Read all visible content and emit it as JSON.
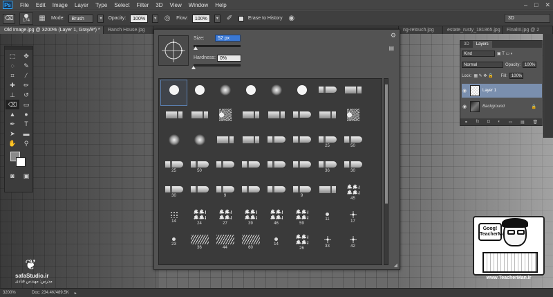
{
  "menubar": {
    "logo": "Ps",
    "items": [
      "File",
      "Edit",
      "Image",
      "Layer",
      "Type",
      "Select",
      "Filter",
      "3D",
      "View",
      "Window",
      "Help"
    ],
    "controls": [
      "–",
      "□",
      "✕"
    ]
  },
  "options": {
    "brush_size": "174",
    "mode_label": "Mode:",
    "mode_value": "Brush",
    "opacity_label": "Opacity:",
    "opacity_value": "100%",
    "flow_label": "Flow:",
    "flow_value": "100%",
    "erase_history_label": "Erase to History",
    "workspace": "3D"
  },
  "tabs": [
    {
      "label": "Old Image.jpg @ 3200% (Layer 1, Gray/8*) *",
      "active": true
    },
    {
      "label": "Ranch House.jpg",
      "active": false
    },
    {
      "label": "",
      "active": false
    },
    {
      "label": "ng-retouch.jpg",
      "active": false
    },
    {
      "label": "estate_rusty_181865.jpg",
      "active": false
    },
    {
      "label": "FinalIII.jpg @ 2",
      "active": false
    }
  ],
  "picker": {
    "size_label": "Size:",
    "size_value": "52 px",
    "hardness_label": "Hardness:",
    "hardness_value": "0%",
    "size_level": 0.05,
    "hardness_level": 0.0,
    "presets": [
      {
        "kind": "hard",
        "num": ""
      },
      {
        "kind": "hard",
        "num": ""
      },
      {
        "kind": "soft",
        "num": ""
      },
      {
        "kind": "hard",
        "num": ""
      },
      {
        "kind": "soft",
        "num": ""
      },
      {
        "kind": "hard",
        "num": ""
      },
      {
        "kind": "tip",
        "num": ""
      },
      {
        "kind": "flat",
        "num": ""
      },
      {
        "kind": "flat",
        "num": ""
      },
      {
        "kind": "flat",
        "num": ""
      },
      {
        "kind": "fan",
        "num": ""
      },
      {
        "kind": "flat",
        "num": ""
      },
      {
        "kind": "flat",
        "num": ""
      },
      {
        "kind": "tip",
        "num": ""
      },
      {
        "kind": "flat",
        "num": ""
      },
      {
        "kind": "fan",
        "num": ""
      },
      {
        "kind": "soft",
        "num": ""
      },
      {
        "kind": "soft",
        "num": ""
      },
      {
        "kind": "flat",
        "num": ""
      },
      {
        "kind": "flat",
        "num": ""
      },
      {
        "kind": "tip",
        "num": ""
      },
      {
        "kind": "tip",
        "num": ""
      },
      {
        "kind": "tip",
        "num": "25"
      },
      {
        "kind": "tip",
        "num": "50"
      },
      {
        "kind": "tip",
        "num": "25"
      },
      {
        "kind": "tip",
        "num": "50"
      },
      {
        "kind": "tip",
        "num": ""
      },
      {
        "kind": "tip",
        "num": ""
      },
      {
        "kind": "tip",
        "num": ""
      },
      {
        "kind": "tip",
        "num": ""
      },
      {
        "kind": "tip",
        "num": "36"
      },
      {
        "kind": "tip",
        "num": "30"
      },
      {
        "kind": "tip",
        "num": "30"
      },
      {
        "kind": "tip",
        "num": ""
      },
      {
        "kind": "tip",
        "num": "9"
      },
      {
        "kind": "tip",
        "num": ""
      },
      {
        "kind": "tip",
        "num": ""
      },
      {
        "kind": "tip",
        "num": "9"
      },
      {
        "kind": "flat",
        "num": ""
      },
      {
        "kind": "splat",
        "num": "45"
      },
      {
        "kind": "dots",
        "num": "14"
      },
      {
        "kind": "splat",
        "num": "24"
      },
      {
        "kind": "splat",
        "num": "27"
      },
      {
        "kind": "splat",
        "num": "39"
      },
      {
        "kind": "splat",
        "num": "46"
      },
      {
        "kind": "splat",
        "num": "59"
      },
      {
        "kind": "small",
        "num": "11"
      },
      {
        "kind": "star",
        "num": "17"
      },
      {
        "kind": "small",
        "num": "23"
      },
      {
        "kind": "grass",
        "num": "36"
      },
      {
        "kind": "grass",
        "num": "44"
      },
      {
        "kind": "grass",
        "num": "60"
      },
      {
        "kind": "small",
        "num": "14"
      },
      {
        "kind": "splat",
        "num": "26"
      },
      {
        "kind": "star",
        "num": "33"
      },
      {
        "kind": "star",
        "num": "42"
      }
    ]
  },
  "layers_panel": {
    "tab_3d": "3D",
    "tab_layers": "Layers",
    "kind_label": "Kind",
    "blend_mode": "Normal",
    "opacity_label": "Opacity:",
    "opacity_value": "100%",
    "lock_label": "Lock:",
    "fill_label": "Fill:",
    "fill_value": "100%",
    "layers": [
      {
        "name": "Layer 1",
        "selected": true
      },
      {
        "name": "Background",
        "selected": false
      }
    ]
  },
  "status": {
    "zoom": "3200%",
    "doc": "Doc: 234.4K/489.5K"
  },
  "watermarks": {
    "left_site": "safaStudio.ir",
    "left_name": "مدرس: مهندس قنادی",
    "right_url": "www.TeacherMan.ir",
    "right_logo": "Goog! TeacherMan"
  }
}
